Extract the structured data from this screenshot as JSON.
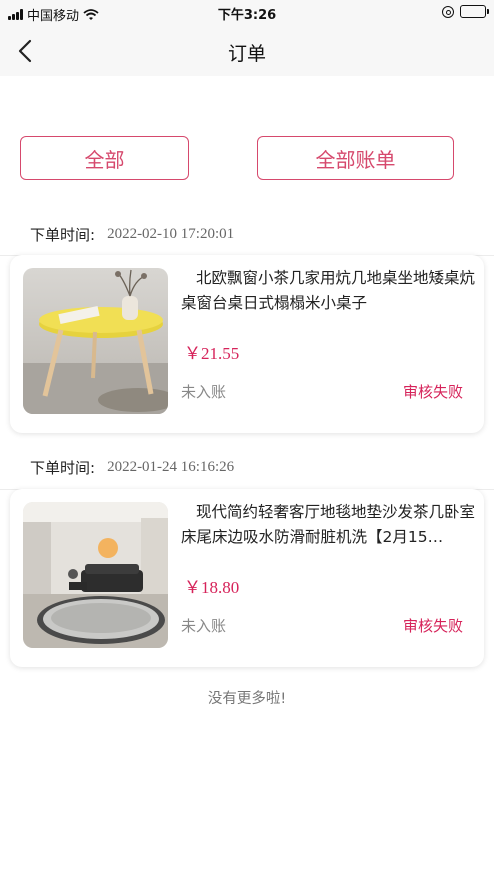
{
  "status_bar": {
    "carrier": "中国移动",
    "time": "下午3:26"
  },
  "nav": {
    "title": "订单"
  },
  "filters": {
    "all_label": "全部",
    "bill_label": "全部账单"
  },
  "orders": [
    {
      "time_label": "下单时间:",
      "time_value": "2022-02-10 17:20:01",
      "title": "北欧飘窗小茶几家用炕几地桌坐地矮桌炕桌窗台桌日式榻榻米小桌子",
      "price": "￥21.55",
      "account_status": "未入账",
      "review_status": "审核失败"
    },
    {
      "time_label": "下单时间:",
      "time_value": "2022-01-24 16:16:26",
      "title": "现代简约轻奢客厅地毯地垫沙发茶几卧室床尾床边吸水防滑耐脏机洗【2月15…",
      "price": "￥18.80",
      "account_status": "未入账",
      "review_status": "审核失败"
    }
  ],
  "footer": {
    "no_more": "没有更多啦!"
  },
  "colors": {
    "accent": "#d6496d",
    "status_red": "#d6235a",
    "battery_green": "#2ecc40"
  },
  "icons": [
    "signal-icon",
    "wifi-icon",
    "orientation-lock-icon",
    "battery-icon",
    "back-arrow-icon"
  ]
}
